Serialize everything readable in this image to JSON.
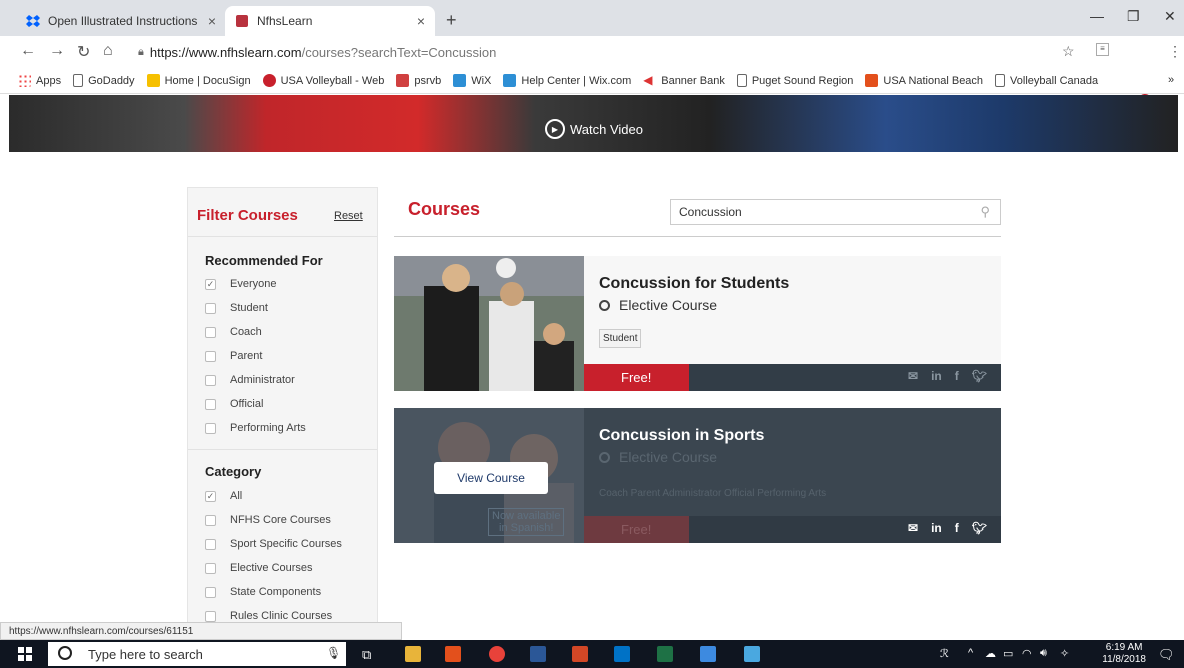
{
  "browser": {
    "tabs": [
      {
        "title": "Open Illustrated Instructions for I"
      },
      {
        "title": "NfhsLearn"
      }
    ],
    "url_host": "https://www.nfhslearn.com",
    "url_path": "/courses?searchText=Concussion",
    "bookmarks": [
      "Apps",
      "GoDaddy",
      "Home | DocuSign",
      "USA Volleyball - Web",
      "psrvb",
      "WiX",
      "Help Center | Wix.com",
      "Banner Bank",
      "Puget Sound Region",
      "USA National Beach",
      "Volleyball Canada"
    ],
    "status_url": "https://www.nfhslearn.com/courses/61151"
  },
  "hero": {
    "watch_video": "Watch Video"
  },
  "filter": {
    "title": "Filter Courses",
    "reset": "Reset",
    "recommended_heading": "Recommended For",
    "recommended": [
      {
        "label": "Everyone",
        "checked": true
      },
      {
        "label": "Student",
        "checked": false
      },
      {
        "label": "Coach",
        "checked": false
      },
      {
        "label": "Parent",
        "checked": false
      },
      {
        "label": "Administrator",
        "checked": false
      },
      {
        "label": "Official",
        "checked": false
      },
      {
        "label": "Performing Arts",
        "checked": false
      }
    ],
    "category_heading": "Category",
    "category": [
      {
        "label": "All",
        "checked": true
      },
      {
        "label": "NFHS Core Courses",
        "checked": false
      },
      {
        "label": "Sport Specific Courses",
        "checked": false
      },
      {
        "label": "Elective Courses",
        "checked": false
      },
      {
        "label": "State Components",
        "checked": false
      },
      {
        "label": "Rules Clinic Courses",
        "checked": false
      }
    ]
  },
  "courses": {
    "title": "Courses",
    "search_value": "Concussion",
    "items": [
      {
        "title": "Concussion for Students",
        "type": "Elective Course",
        "tags": "Student",
        "price": "Free!"
      },
      {
        "title": "Concussion in Sports",
        "type": "Elective Course",
        "tags": "Coach  Parent  Administrator  Official  Performing Arts",
        "price": "Free!",
        "view_button": "View Course",
        "spanish_line1": "Now available",
        "spanish_line2": "in Spanish!"
      }
    ]
  },
  "taskbar": {
    "search_placeholder": "Type here to search",
    "time": "6:19 AM",
    "date": "11/8/2018"
  }
}
